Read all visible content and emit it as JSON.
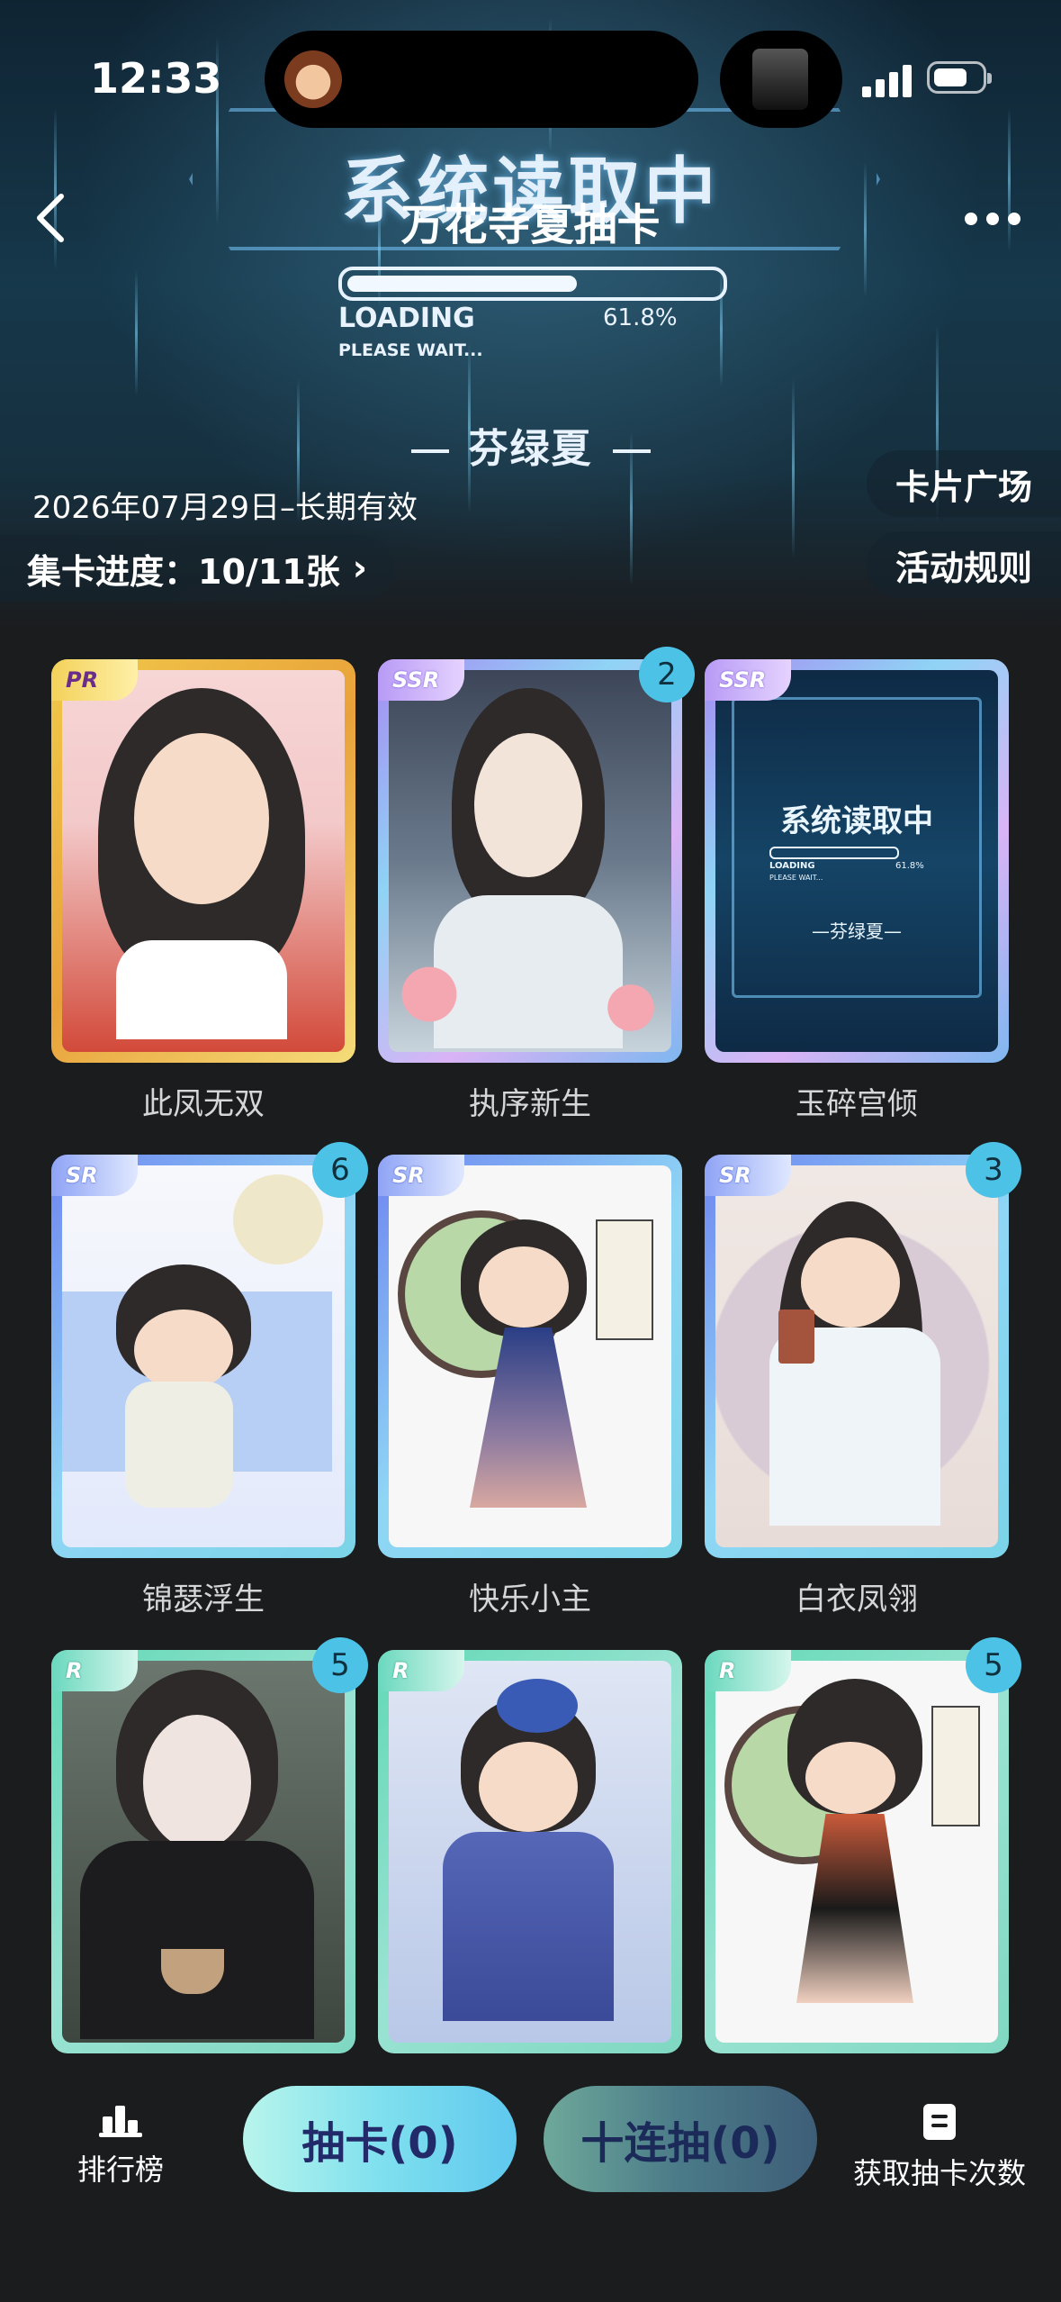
{
  "status_bar": {
    "time": "12:33"
  },
  "banner": {
    "hud_title": "系统读取中",
    "loading_label": "LOADING",
    "loading_percent": "61.8%",
    "loading_value": 0.618,
    "please_wait": "PLEASE WAIT...",
    "subtitle": "芬绿夏"
  },
  "header": {
    "title": "万花寺夏抽卡"
  },
  "info": {
    "validity": "2026年07月29日–长期有效",
    "progress_label": "集卡进度：10/11张",
    "card_square": "卡片广场",
    "rules": "活动规则"
  },
  "cards": [
    {
      "name": "此凤无双",
      "rarity": "PR",
      "count": ""
    },
    {
      "name": "执序新生",
      "rarity": "SSR",
      "count": "2"
    },
    {
      "name": "玉碎宫倾",
      "rarity": "SSR",
      "count": ""
    },
    {
      "name": "锦瑟浮生",
      "rarity": "SR",
      "count": "6"
    },
    {
      "name": "快乐小主",
      "rarity": "SR",
      "count": ""
    },
    {
      "name": "白衣凤翎",
      "rarity": "SR",
      "count": "3"
    },
    {
      "name": "",
      "rarity": "R",
      "count": "5"
    },
    {
      "name": "",
      "rarity": "R",
      "count": ""
    },
    {
      "name": "",
      "rarity": "R",
      "count": "5"
    }
  ],
  "card_inner": {
    "hud_title": "系统读取中",
    "loading": "LOADING",
    "percent": "61.8%",
    "wait": "PLEASE WAIT...",
    "subtitle": "—芬绿夏—"
  },
  "bottom": {
    "ranking": "排行榜",
    "draw": "抽卡(0)",
    "draw_ten": "十连抽(0)",
    "get_draws": "获取抽卡次数"
  },
  "colors": {
    "accent": "#4cc3e6",
    "background": "#1b1c1e",
    "draw_button": "#7ee6f0",
    "draw_ten_button": "#5a9a9a"
  }
}
